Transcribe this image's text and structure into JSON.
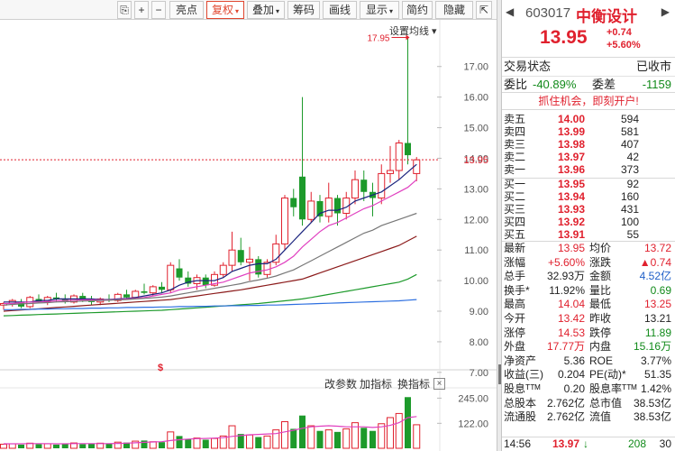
{
  "toolbar": {
    "buttons": [
      {
        "label": "⎘",
        "name": "window-icon-button",
        "active": false,
        "dropdown": false
      },
      {
        "label": "+",
        "name": "zoom-in-button",
        "active": false,
        "dropdown": false
      },
      {
        "label": "−",
        "name": "zoom-out-button",
        "active": false,
        "dropdown": false
      },
      {
        "label": "亮点",
        "name": "highlights-button",
        "active": false,
        "dropdown": false
      },
      {
        "label": "复权",
        "name": "adjust-button",
        "active": true,
        "dropdown": true
      },
      {
        "label": "叠加",
        "name": "overlay-button",
        "active": false,
        "dropdown": true
      },
      {
        "label": "筹码",
        "name": "chips-button",
        "active": false,
        "dropdown": false
      },
      {
        "label": "画线",
        "name": "draw-line-button",
        "active": false,
        "dropdown": false
      },
      {
        "label": "显示",
        "name": "display-button",
        "active": false,
        "dropdown": true
      },
      {
        "label": "简约",
        "name": "simple-button",
        "active": false,
        "dropdown": false
      },
      {
        "label": "隐藏",
        "name": "hide-button",
        "active": false,
        "dropdown": false
      },
      {
        "label": "⇱",
        "name": "maximize-button",
        "active": false,
        "dropdown": false
      }
    ]
  },
  "chart": {
    "setting_label": "设置均线 ▾",
    "high_marker": "17.95",
    "current_price_label": "13.95",
    "signal_marker": "$",
    "sub_buttons": [
      "改参数",
      "加指标",
      "换指标"
    ],
    "close_label": "×"
  },
  "chart_data": [
    {
      "type": "candlestick",
      "title": "",
      "y_ticks": [
        "17.00",
        "16.00",
        "15.00",
        "14.00",
        "13.00",
        "12.00",
        "11.00",
        "10.00",
        "9.00",
        "8.00",
        "7.00"
      ],
      "ylim": [
        6.7,
        17.7
      ],
      "candles": [
        {
          "o": 9.2,
          "h": 9.3,
          "l": 9.05,
          "c": 9.25
        },
        {
          "o": 9.25,
          "h": 9.4,
          "l": 9.15,
          "c": 9.35
        },
        {
          "o": 9.3,
          "h": 9.4,
          "l": 9.1,
          "c": 9.15
        },
        {
          "o": 9.15,
          "h": 9.5,
          "l": 9.1,
          "c": 9.45
        },
        {
          "o": 9.4,
          "h": 9.55,
          "l": 9.25,
          "c": 9.3
        },
        {
          "o": 9.3,
          "h": 9.5,
          "l": 9.2,
          "c": 9.45
        },
        {
          "o": 9.45,
          "h": 9.6,
          "l": 9.3,
          "c": 9.4
        },
        {
          "o": 9.4,
          "h": 9.55,
          "l": 9.25,
          "c": 9.3
        },
        {
          "o": 9.3,
          "h": 9.55,
          "l": 9.25,
          "c": 9.5
        },
        {
          "o": 9.5,
          "h": 9.6,
          "l": 9.3,
          "c": 9.35
        },
        {
          "o": 9.35,
          "h": 9.5,
          "l": 9.2,
          "c": 9.3
        },
        {
          "o": 9.3,
          "h": 9.45,
          "l": 9.2,
          "c": 9.4
        },
        {
          "o": 9.4,
          "h": 9.55,
          "l": 9.3,
          "c": 9.35
        },
        {
          "o": 9.35,
          "h": 9.6,
          "l": 9.3,
          "c": 9.55
        },
        {
          "o": 9.55,
          "h": 9.7,
          "l": 9.4,
          "c": 9.45
        },
        {
          "o": 9.45,
          "h": 9.7,
          "l": 9.4,
          "c": 9.65
        },
        {
          "o": 9.65,
          "h": 9.9,
          "l": 9.55,
          "c": 9.6
        },
        {
          "o": 9.6,
          "h": 9.85,
          "l": 9.5,
          "c": 9.8
        },
        {
          "o": 9.8,
          "h": 9.95,
          "l": 9.6,
          "c": 9.7
        },
        {
          "o": 9.7,
          "h": 10.6,
          "l": 9.6,
          "c": 10.5
        },
        {
          "o": 10.4,
          "h": 10.7,
          "l": 10.0,
          "c": 10.1
        },
        {
          "o": 10.1,
          "h": 10.3,
          "l": 9.8,
          "c": 9.9
        },
        {
          "o": 9.9,
          "h": 10.2,
          "l": 9.7,
          "c": 10.1
        },
        {
          "o": 10.1,
          "h": 10.2,
          "l": 9.75,
          "c": 9.85
        },
        {
          "o": 9.85,
          "h": 10.3,
          "l": 9.8,
          "c": 10.2
        },
        {
          "o": 10.2,
          "h": 10.6,
          "l": 10.1,
          "c": 10.5
        },
        {
          "o": 10.5,
          "h": 11.6,
          "l": 10.3,
          "c": 11.0
        },
        {
          "o": 11.0,
          "h": 11.4,
          "l": 10.5,
          "c": 10.6
        },
        {
          "o": 10.6,
          "h": 11.1,
          "l": 10.0,
          "c": 10.7
        },
        {
          "o": 10.7,
          "h": 10.8,
          "l": 10.1,
          "c": 10.2
        },
        {
          "o": 10.2,
          "h": 10.7,
          "l": 10.1,
          "c": 10.6
        },
        {
          "o": 10.6,
          "h": 11.5,
          "l": 10.5,
          "c": 11.2
        },
        {
          "o": 11.2,
          "h": 12.8,
          "l": 11.0,
          "c": 12.7
        },
        {
          "o": 12.7,
          "h": 13.0,
          "l": 12.1,
          "c": 12.4
        },
        {
          "o": 13.4,
          "h": 16.0,
          "l": 11.8,
          "c": 12.0
        },
        {
          "o": 12.0,
          "h": 12.9,
          "l": 11.9,
          "c": 12.6
        },
        {
          "o": 12.6,
          "h": 12.8,
          "l": 11.9,
          "c": 12.1
        },
        {
          "o": 12.1,
          "h": 13.2,
          "l": 11.9,
          "c": 12.7
        },
        {
          "o": 12.7,
          "h": 12.8,
          "l": 11.8,
          "c": 12.2
        },
        {
          "o": 12.2,
          "h": 12.9,
          "l": 12.0,
          "c": 12.7
        },
        {
          "o": 12.7,
          "h": 13.6,
          "l": 12.5,
          "c": 13.3
        },
        {
          "o": 13.3,
          "h": 13.6,
          "l": 12.6,
          "c": 12.9
        },
        {
          "o": 12.9,
          "h": 13.2,
          "l": 12.1,
          "c": 12.7
        },
        {
          "o": 12.7,
          "h": 13.8,
          "l": 12.5,
          "c": 13.5
        },
        {
          "o": 13.5,
          "h": 14.4,
          "l": 13.2,
          "c": 13.6
        },
        {
          "o": 13.6,
          "h": 14.6,
          "l": 13.3,
          "c": 14.5
        },
        {
          "o": 14.5,
          "h": 17.95,
          "l": 13.8,
          "c": 14.1
        },
        {
          "o": 13.5,
          "h": 14.04,
          "l": 13.25,
          "c": 13.95
        }
      ],
      "ma_lines": [
        {
          "color": "#1a237e",
          "values": [
            9.3,
            9.3,
            9.3,
            9.3,
            9.35,
            9.35,
            9.4,
            9.4,
            9.4,
            9.4,
            9.4,
            9.38,
            9.38,
            9.4,
            9.42,
            9.45,
            9.5,
            9.55,
            9.6,
            9.7,
            9.85,
            9.95,
            10.0,
            10.0,
            10.0,
            10.1,
            10.3,
            10.4,
            10.5,
            10.55,
            10.55,
            10.7,
            11.0,
            11.3,
            11.6,
            11.9,
            12.2,
            12.3,
            12.3,
            12.4,
            12.6,
            12.7,
            12.8,
            12.9,
            13.1,
            13.3,
            13.55,
            13.8
          ]
        },
        {
          "color": "#e040c0",
          "values": [
            9.25,
            9.25,
            9.28,
            9.3,
            9.3,
            9.32,
            9.34,
            9.35,
            9.36,
            9.37,
            9.37,
            9.37,
            9.37,
            9.38,
            9.4,
            9.42,
            9.45,
            9.5,
            9.55,
            9.6,
            9.7,
            9.75,
            9.8,
            9.85,
            9.9,
            9.95,
            10.05,
            10.15,
            10.25,
            10.3,
            10.35,
            10.45,
            10.6,
            10.8,
            11.1,
            11.35,
            11.6,
            11.8,
            11.9,
            12.05,
            12.2,
            12.35,
            12.45,
            12.6,
            12.75,
            12.9,
            13.05,
            13.3
          ]
        },
        {
          "color": "#777777",
          "values": [
            9.2,
            9.22,
            9.24,
            9.25,
            9.27,
            9.28,
            9.3,
            9.31,
            9.32,
            9.33,
            9.34,
            9.35,
            9.36,
            9.37,
            9.38,
            9.4,
            9.42,
            9.44,
            9.46,
            9.5,
            9.55,
            9.6,
            9.65,
            9.7,
            9.75,
            9.8,
            9.85,
            9.9,
            9.97,
            10.02,
            10.08,
            10.15,
            10.25,
            10.35,
            10.5,
            10.65,
            10.8,
            10.95,
            11.1,
            11.25,
            11.4,
            11.55,
            11.65,
            11.8,
            11.9,
            12.0,
            12.1,
            12.2
          ]
        },
        {
          "color": "#8b1a1a",
          "values": [
            9.0,
            9.02,
            9.04,
            9.06,
            9.08,
            9.1,
            9.12,
            9.14,
            9.16,
            9.18,
            9.2,
            9.22,
            9.24,
            9.26,
            9.28,
            9.3,
            9.32,
            9.34,
            9.36,
            9.38,
            9.42,
            9.46,
            9.5,
            9.54,
            9.58,
            9.62,
            9.66,
            9.7,
            9.75,
            9.8,
            9.85,
            9.9,
            9.95,
            10.0,
            10.05,
            10.15,
            10.25,
            10.35,
            10.45,
            10.55,
            10.65,
            10.75,
            10.85,
            10.95,
            11.05,
            11.15,
            11.3,
            11.45
          ]
        },
        {
          "color": "#1d9a2b",
          "values": [
            8.85,
            8.86,
            8.87,
            8.88,
            8.89,
            8.9,
            8.91,
            8.92,
            8.93,
            8.94,
            8.95,
            8.96,
            8.97,
            8.98,
            8.99,
            9.0,
            9.01,
            9.02,
            9.03,
            9.05,
            9.07,
            9.09,
            9.11,
            9.13,
            9.15,
            9.17,
            9.19,
            9.21,
            9.23,
            9.25,
            9.28,
            9.31,
            9.34,
            9.37,
            9.4,
            9.45,
            9.5,
            9.55,
            9.6,
            9.65,
            9.7,
            9.75,
            9.8,
            9.85,
            9.9,
            9.95,
            10.05,
            10.2
          ]
        },
        {
          "color": "#2d6fe0",
          "values": [
            9.05,
            9.05,
            9.06,
            9.06,
            9.07,
            9.07,
            9.08,
            9.08,
            9.09,
            9.09,
            9.1,
            9.1,
            9.11,
            9.11,
            9.12,
            9.12,
            9.13,
            9.13,
            9.14,
            9.14,
            9.15,
            9.15,
            9.16,
            9.16,
            9.17,
            9.17,
            9.18,
            9.18,
            9.19,
            9.19,
            9.2,
            9.2,
            9.21,
            9.22,
            9.23,
            9.24,
            9.25,
            9.26,
            9.27,
            9.28,
            9.29,
            9.3,
            9.31,
            9.32,
            9.33,
            9.34,
            9.36,
            9.38
          ]
        }
      ]
    },
    {
      "type": "bar",
      "title": "",
      "y_ticks": [
        "245.00",
        "122.00"
      ],
      "ylim": [
        0,
        260
      ],
      "values": [
        20,
        22,
        18,
        25,
        20,
        22,
        18,
        24,
        26,
        20,
        22,
        25,
        24,
        30,
        28,
        35,
        38,
        32,
        30,
        80,
        60,
        45,
        50,
        42,
        48,
        60,
        110,
        70,
        65,
        55,
        60,
        90,
        130,
        95,
        160,
        110,
        85,
        90,
        80,
        95,
        125,
        100,
        85,
        120,
        150,
        170,
        250,
        115
      ],
      "ma_values": [
        22,
        22,
        22,
        23,
        23,
        23,
        22,
        22,
        23,
        23,
        23,
        23,
        23,
        24,
        25,
        27,
        29,
        31,
        32,
        38,
        42,
        45,
        47,
        48,
        50,
        52,
        58,
        62,
        66,
        68,
        70,
        72,
        80,
        88,
        98,
        105,
        108,
        110,
        108,
        105,
        105,
        105,
        102,
        105,
        112,
        125,
        150,
        155
      ]
    }
  ],
  "panel": {
    "nav_left": "◀",
    "nav_right": "▶",
    "code": "603017",
    "name": "中衡设计",
    "price": "13.95",
    "change": "+0.74",
    "change_pct": "+5.60%",
    "status_label": "交易状态",
    "status_value": "已收市",
    "wb_label": "委比",
    "wb_value": "-40.89%",
    "wc_label": "委差",
    "wc_value": "-1159",
    "promo": "抓住机会，即刻开户!",
    "sell": [
      {
        "label": "卖五",
        "price": "14.00",
        "vol": "594"
      },
      {
        "label": "卖四",
        "price": "13.99",
        "vol": "581"
      },
      {
        "label": "卖三",
        "price": "13.98",
        "vol": "407"
      },
      {
        "label": "卖二",
        "price": "13.97",
        "vol": "42"
      },
      {
        "label": "卖一",
        "price": "13.96",
        "vol": "373"
      }
    ],
    "buy": [
      {
        "label": "买一",
        "price": "13.95",
        "vol": "92"
      },
      {
        "label": "买二",
        "price": "13.94",
        "vol": "160"
      },
      {
        "label": "买三",
        "price": "13.93",
        "vol": "431"
      },
      {
        "label": "买四",
        "price": "13.92",
        "vol": "100"
      },
      {
        "label": "买五",
        "price": "13.91",
        "vol": "55"
      }
    ],
    "stats": [
      {
        "k1": "最新",
        "v1": "13.95",
        "c1": "red",
        "k2": "均价",
        "v2": "13.72",
        "c2": "red"
      },
      {
        "k1": "涨幅",
        "v1": "+5.60%",
        "c1": "red",
        "k2": "涨跌",
        "v2": "▲0.74",
        "c2": "red"
      },
      {
        "k1": "总手",
        "v1": "32.93万",
        "c1": "blk",
        "k2": "金额",
        "v2": "4.52亿",
        "c2": "blue"
      },
      {
        "k1": "换手*",
        "v1": "11.92%",
        "c1": "blk",
        "k2": "量比",
        "v2": "0.69",
        "c2": "green"
      },
      {
        "k1": "最高",
        "v1": "14.04",
        "c1": "red",
        "k2": "最低",
        "v2": "13.25",
        "c2": "red"
      },
      {
        "k1": "今开",
        "v1": "13.42",
        "c1": "red",
        "k2": "昨收",
        "v2": "13.21",
        "c2": "blk"
      },
      {
        "k1": "涨停",
        "v1": "14.53",
        "c1": "red",
        "k2": "跌停",
        "v2": "11.89",
        "c2": "green"
      },
      {
        "k1": "外盘",
        "v1": "17.77万",
        "c1": "red",
        "k2": "内盘",
        "v2": "15.16万",
        "c2": "green"
      },
      {
        "k1": "净资产",
        "v1": "5.36",
        "c1": "blk",
        "k2": "ROE",
        "v2": "3.77%",
        "c2": "blk"
      },
      {
        "k1": "收益(三)",
        "v1": "0.204",
        "c1": "blk",
        "k2": "PE(动)*",
        "v2": "51.35",
        "c2": "blk"
      },
      {
        "k1": "股息ᵀᵀᴹ",
        "v1": "0.20",
        "c1": "blk",
        "k2": "股息率ᵀᵀᴹ",
        "v2": "1.42%",
        "c2": "blk"
      },
      {
        "k1": "总股本",
        "v1": "2.762亿",
        "c1": "blk",
        "k2": "总市值",
        "v2": "38.53亿",
        "c2": "blk"
      },
      {
        "k1": "流通股",
        "v1": "2.762亿",
        "c1": "blk",
        "k2": "流值",
        "v2": "38.53亿",
        "c2": "blk"
      }
    ],
    "footer": {
      "time": "14:56",
      "price": "13.97",
      "arrow": "↓",
      "vol": "208",
      "extra": "30"
    }
  }
}
